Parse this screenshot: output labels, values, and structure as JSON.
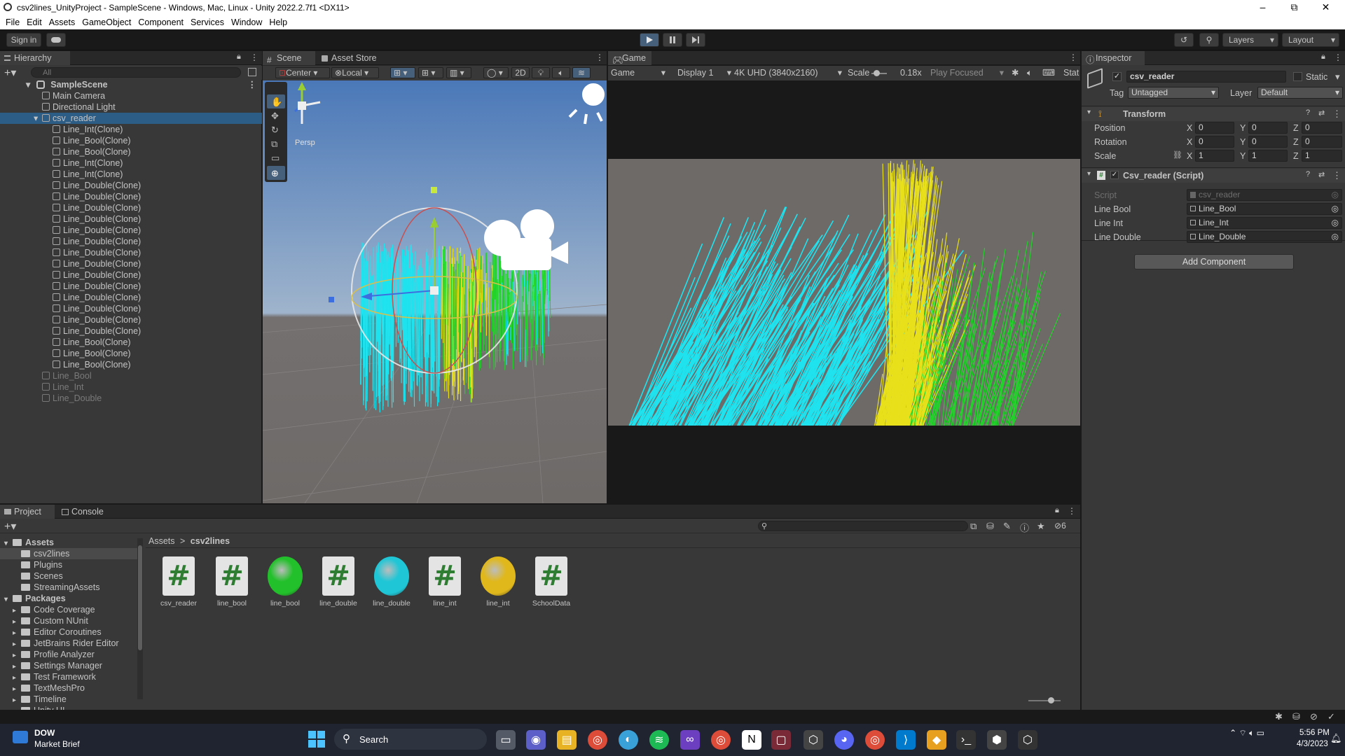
{
  "window": {
    "title": "csv2lines_UnityProject - SampleScene - Windows, Mac, Linux - Unity 2022.2.7f1 <DX11>",
    "minimize": "–",
    "maximize": "⧉",
    "close": "✕"
  },
  "menu": [
    "File",
    "Edit",
    "Assets",
    "GameObject",
    "Component",
    "Services",
    "Window",
    "Help"
  ],
  "toolbar": {
    "sign_in": "Sign in",
    "layers": "Layers",
    "layout": "Layout"
  },
  "hierarchy": {
    "tab": "Hierarchy",
    "search_placeholder": "All",
    "scene": "SampleScene",
    "items": [
      {
        "label": "Main Camera",
        "indent": 1,
        "state": "normal"
      },
      {
        "label": "Directional Light",
        "indent": 1,
        "state": "normal"
      },
      {
        "label": "csv_reader",
        "indent": 1,
        "state": "selected"
      },
      {
        "label": "Line_Int(Clone)",
        "indent": 2,
        "state": "normal"
      },
      {
        "label": "Line_Bool(Clone)",
        "indent": 2,
        "state": "normal"
      },
      {
        "label": "Line_Bool(Clone)",
        "indent": 2,
        "state": "normal"
      },
      {
        "label": "Line_Int(Clone)",
        "indent": 2,
        "state": "normal"
      },
      {
        "label": "Line_Int(Clone)",
        "indent": 2,
        "state": "normal"
      },
      {
        "label": "Line_Double(Clone)",
        "indent": 2,
        "state": "normal"
      },
      {
        "label": "Line_Double(Clone)",
        "indent": 2,
        "state": "normal"
      },
      {
        "label": "Line_Double(Clone)",
        "indent": 2,
        "state": "normal"
      },
      {
        "label": "Line_Double(Clone)",
        "indent": 2,
        "state": "normal"
      },
      {
        "label": "Line_Double(Clone)",
        "indent": 2,
        "state": "normal"
      },
      {
        "label": "Line_Double(Clone)",
        "indent": 2,
        "state": "normal"
      },
      {
        "label": "Line_Double(Clone)",
        "indent": 2,
        "state": "normal"
      },
      {
        "label": "Line_Double(Clone)",
        "indent": 2,
        "state": "normal"
      },
      {
        "label": "Line_Double(Clone)",
        "indent": 2,
        "state": "normal"
      },
      {
        "label": "Line_Double(Clone)",
        "indent": 2,
        "state": "normal"
      },
      {
        "label": "Line_Double(Clone)",
        "indent": 2,
        "state": "normal"
      },
      {
        "label": "Line_Double(Clone)",
        "indent": 2,
        "state": "normal"
      },
      {
        "label": "Line_Double(Clone)",
        "indent": 2,
        "state": "normal"
      },
      {
        "label": "Line_Double(Clone)",
        "indent": 2,
        "state": "normal"
      },
      {
        "label": "Line_Bool(Clone)",
        "indent": 2,
        "state": "normal"
      },
      {
        "label": "Line_Bool(Clone)",
        "indent": 2,
        "state": "normal"
      },
      {
        "label": "Line_Bool(Clone)",
        "indent": 2,
        "state": "normal"
      },
      {
        "label": "Line_Bool",
        "indent": 1,
        "state": "disabled"
      },
      {
        "label": "Line_Int",
        "indent": 1,
        "state": "disabled"
      },
      {
        "label": "Line_Double",
        "indent": 1,
        "state": "disabled"
      }
    ]
  },
  "scene": {
    "tab_scene": "Scene",
    "tab_store": "Asset Store",
    "pivot": "Center",
    "space": "Local",
    "mode_2d": "2D",
    "persp": "Persp"
  },
  "game": {
    "tab": "Game",
    "mode": "Game",
    "display": "Display 1",
    "resolution": "4K UHD (3840x2160)",
    "scale_label": "Scale",
    "scale_value": "0.18x",
    "play_focused": "Play Focused",
    "stats": "Stat"
  },
  "inspector": {
    "tab": "Inspector",
    "object_name": "csv_reader",
    "static": "Static",
    "tag_label": "Tag",
    "tag_value": "Untagged",
    "layer_label": "Layer",
    "layer_value": "Default",
    "transform": {
      "title": "Transform",
      "rows": [
        {
          "label": "Position",
          "x": "0",
          "y": "0",
          "z": "0"
        },
        {
          "label": "Rotation",
          "x": "0",
          "y": "0",
          "z": "0"
        },
        {
          "label": "Scale",
          "x": "1",
          "y": "1",
          "z": "1"
        }
      ]
    },
    "script": {
      "title": "Csv_reader (Script)",
      "script_label": "Script",
      "script_value": "csv_reader",
      "fields": [
        {
          "label": "Line Bool",
          "value": "Line_Bool"
        },
        {
          "label": "Line Int",
          "value": "Line_Int"
        },
        {
          "label": "Line Double",
          "value": "Line_Double"
        }
      ]
    },
    "add_component": "Add Component"
  },
  "project": {
    "tab_project": "Project",
    "tab_console": "Console",
    "breadcrumb_root": "Assets",
    "breadcrumb_sep": ">",
    "breadcrumb_folder": "csv2lines",
    "hidden_count": "6",
    "tree": [
      {
        "label": "Assets",
        "indent": 0,
        "bold": true
      },
      {
        "label": "csv2lines",
        "indent": 1,
        "selected": true
      },
      {
        "label": "Plugins",
        "indent": 1
      },
      {
        "label": "Scenes",
        "indent": 1
      },
      {
        "label": "StreamingAssets",
        "indent": 1
      },
      {
        "label": "Packages",
        "indent": 0,
        "bold": true
      },
      {
        "label": "Code Coverage",
        "indent": 1
      },
      {
        "label": "Custom NUnit",
        "indent": 1
      },
      {
        "label": "Editor Coroutines",
        "indent": 1
      },
      {
        "label": "JetBrains Rider Editor",
        "indent": 1
      },
      {
        "label": "Profile Analyzer",
        "indent": 1
      },
      {
        "label": "Settings Manager",
        "indent": 1
      },
      {
        "label": "Test Framework",
        "indent": 1
      },
      {
        "label": "TextMeshPro",
        "indent": 1
      },
      {
        "label": "Timeline",
        "indent": 1
      },
      {
        "label": "Unity UI",
        "indent": 1
      }
    ],
    "assets": [
      {
        "label": "csv_reader",
        "kind": "script",
        "color": "#e4e4e4"
      },
      {
        "label": "line_bool",
        "kind": "script",
        "color": "#e4e4e4"
      },
      {
        "label": "line_bool",
        "kind": "material",
        "color": "#22c02a"
      },
      {
        "label": "line_double",
        "kind": "script",
        "color": "#e4e4e4"
      },
      {
        "label": "line_double",
        "kind": "material",
        "color": "#1fc6d6"
      },
      {
        "label": "line_int",
        "kind": "script",
        "color": "#e4e4e4"
      },
      {
        "label": "line_int",
        "kind": "material",
        "color": "#e0b81c"
      },
      {
        "label": "SchoolData",
        "kind": "script",
        "color": "#e4e4e4"
      }
    ]
  },
  "taskbar": {
    "widget_title": "DOW",
    "widget_sub": "Market Brief",
    "search": "Search",
    "time": "5:56 PM",
    "date": "4/3/2023"
  },
  "colors": {
    "cyan": "#1fe3ef",
    "yellow": "#e8e01a",
    "green": "#22d32a",
    "selection": "#2c5d87"
  }
}
